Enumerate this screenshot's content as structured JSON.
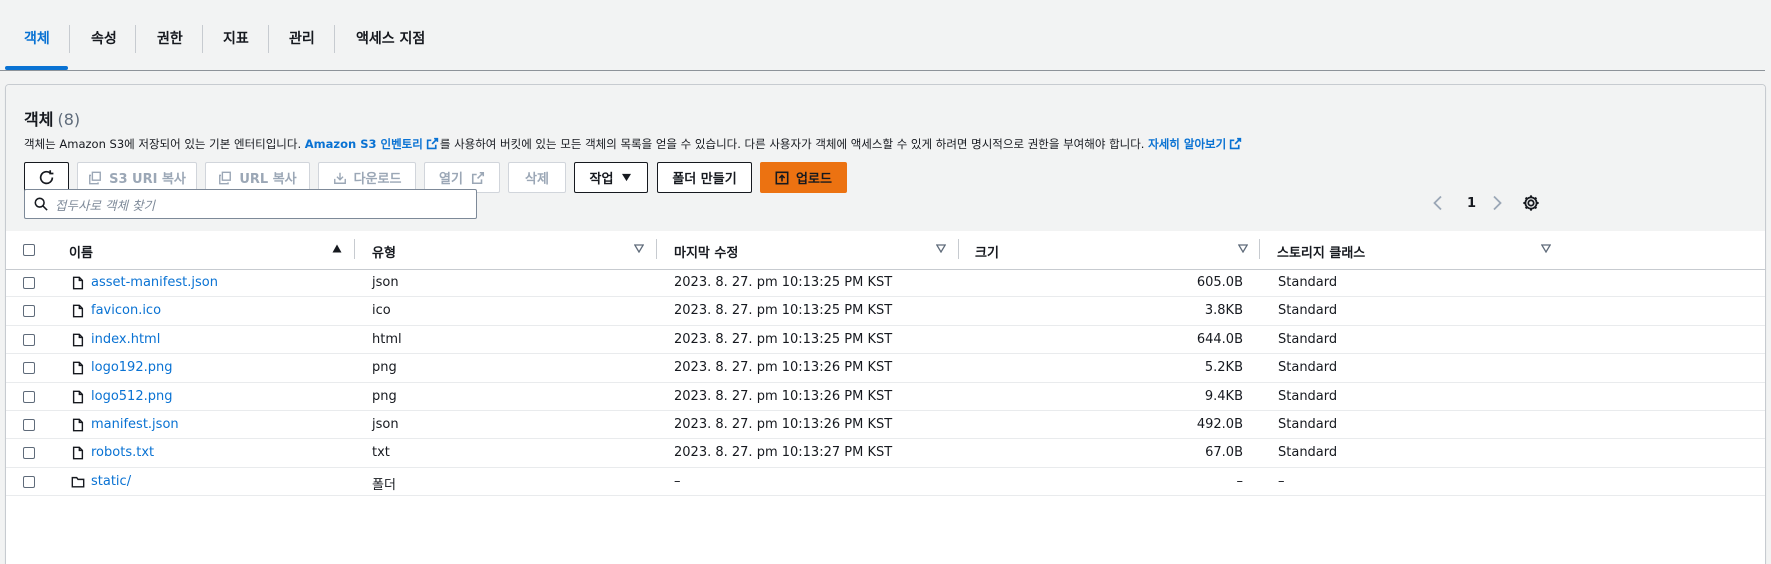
{
  "tabs": [
    {
      "label": "객체",
      "active": true
    },
    {
      "label": "속성"
    },
    {
      "label": "권한"
    },
    {
      "label": "지표"
    },
    {
      "label": "관리"
    },
    {
      "label": "액세스 지점"
    }
  ],
  "panel": {
    "title": "객체",
    "count": "(8)",
    "description": {
      "part1": "객체는 Amazon S3에 저장되어 있는 기본 엔터티입니다.",
      "link1": "Amazon S3 인벤토리",
      "part2": "를 사용하여 버킷에 있는 모든 객체의 목록을 얻을 수 있습니다. 다른 사용자가 객체에 액세스할 수 있게 하려면 명시적으로 권한을 부여해야 합니다.",
      "link2": "자세히 알아보기"
    }
  },
  "toolbar": {
    "refresh_icon": "refresh-icon",
    "copy_s3_uri": "S3 URI 복사",
    "copy_url": "URL 복사",
    "download": "다운로드",
    "open": "열기",
    "delete": "삭제",
    "actions": "작업",
    "create_folder": "폴더 만들기",
    "upload": "업로드"
  },
  "search": {
    "placeholder": "접두사로 객체 찾기",
    "value": ""
  },
  "pagination": {
    "current_page": "1"
  },
  "table": {
    "columns": [
      "이름",
      "유형",
      "마지막 수정",
      "크기",
      "스토리지 클래스"
    ],
    "rows": [
      {
        "name": "asset-manifest.json",
        "type": "json",
        "modified": "2023. 8. 27. pm 10:13:25 PM KST",
        "size": "605.0B",
        "storage": "Standard",
        "icon": "file-icon"
      },
      {
        "name": "favicon.ico",
        "type": "ico",
        "modified": "2023. 8. 27. pm 10:13:25 PM KST",
        "size": "3.8KB",
        "storage": "Standard",
        "icon": "file-icon"
      },
      {
        "name": "index.html",
        "type": "html",
        "modified": "2023. 8. 27. pm 10:13:25 PM KST",
        "size": "644.0B",
        "storage": "Standard",
        "icon": "file-icon"
      },
      {
        "name": "logo192.png",
        "type": "png",
        "modified": "2023. 8. 27. pm 10:13:26 PM KST",
        "size": "5.2KB",
        "storage": "Standard",
        "icon": "file-icon"
      },
      {
        "name": "logo512.png",
        "type": "png",
        "modified": "2023. 8. 27. pm 10:13:26 PM KST",
        "size": "9.4KB",
        "storage": "Standard",
        "icon": "file-icon"
      },
      {
        "name": "manifest.json",
        "type": "json",
        "modified": "2023. 8. 27. pm 10:13:26 PM KST",
        "size": "492.0B",
        "storage": "Standard",
        "icon": "file-icon"
      },
      {
        "name": "robots.txt",
        "type": "txt",
        "modified": "2023. 8. 27. pm 10:13:27 PM KST",
        "size": "67.0B",
        "storage": "Standard",
        "icon": "file-icon"
      },
      {
        "name": "static/",
        "type": "폴더",
        "modified": "–",
        "size": "–",
        "storage": "–",
        "icon": "folder-icon"
      }
    ]
  },
  "colors": {
    "accent": "#0972d3",
    "primary_button": "#ec7211",
    "text": "#16191f",
    "disabled": "#9ba7b6"
  }
}
